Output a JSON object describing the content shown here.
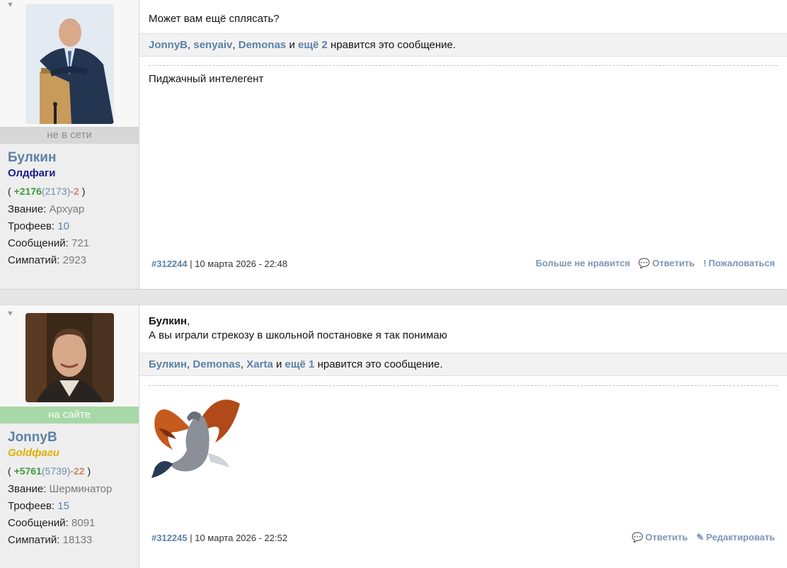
{
  "posts": [
    {
      "user": {
        "status": "не в сети",
        "name": "Булкин",
        "rank": "Олдфаги",
        "rep_open": "(",
        "rep_pos": "+2176",
        "rep_total": "(2173)",
        "rep_neg": "-2",
        "rep_close": ")",
        "title_label": "Звание:",
        "title_value": "Архуар",
        "trophies_label": "Трофеев:",
        "trophies_value": "10",
        "messages_label": "Сообщений:",
        "messages_value": "721",
        "likes_label": "Симпатий:",
        "likes_value": "2923"
      },
      "message": "Может вам ещё сплясать?",
      "likes": {
        "names": [
          "JonnyB",
          "senyaiv",
          "Demonas"
        ],
        "and": "и",
        "more": "ещё 2",
        "suffix": "нравится это сообщение."
      },
      "signature": "Пиджачный интелегент",
      "footer": {
        "number": "#312244",
        "date": "| 10 марта 2026 - 22:48",
        "actions": [
          "Больше не нравится",
          "Ответить",
          "Пожаловаться"
        ]
      }
    },
    {
      "user": {
        "status": "на сайте",
        "name": "JonnyB",
        "rank": "Goldфаги",
        "rep_open": "(",
        "rep_pos": "+5761",
        "rep_total": "(5739)",
        "rep_neg": "-22",
        "rep_close": ")",
        "title_label": "Звание:",
        "title_value": "Шерминатор",
        "trophies_label": "Трофеев:",
        "trophies_value": "15",
        "messages_label": "Сообщений:",
        "messages_value": "8091",
        "likes_label": "Симпатий:",
        "likes_value": "18133"
      },
      "quote_author": "Булкин",
      "message": "А вы играли стрекозу в школьной постановке я так понимаю",
      "likes": {
        "names": [
          "Булкин",
          "Demonas",
          "Xarta"
        ],
        "and": "и",
        "more": "ещё 1",
        "suffix": "нравится это сообщение."
      },
      "footer": {
        "number": "#312245",
        "date": "| 10 марта 2026 - 22:52",
        "actions": [
          "Ответить",
          "Редактировать"
        ]
      }
    }
  ],
  "colors": {
    "link": "#5b82a8",
    "positive": "#3d9a3d",
    "negative": "#c88a6e",
    "online": "#a7d8a7"
  },
  "icons": [
    "collapse-arrow-icon",
    "speech-bubble-icon",
    "exclamation-icon",
    "pencil-icon"
  ]
}
